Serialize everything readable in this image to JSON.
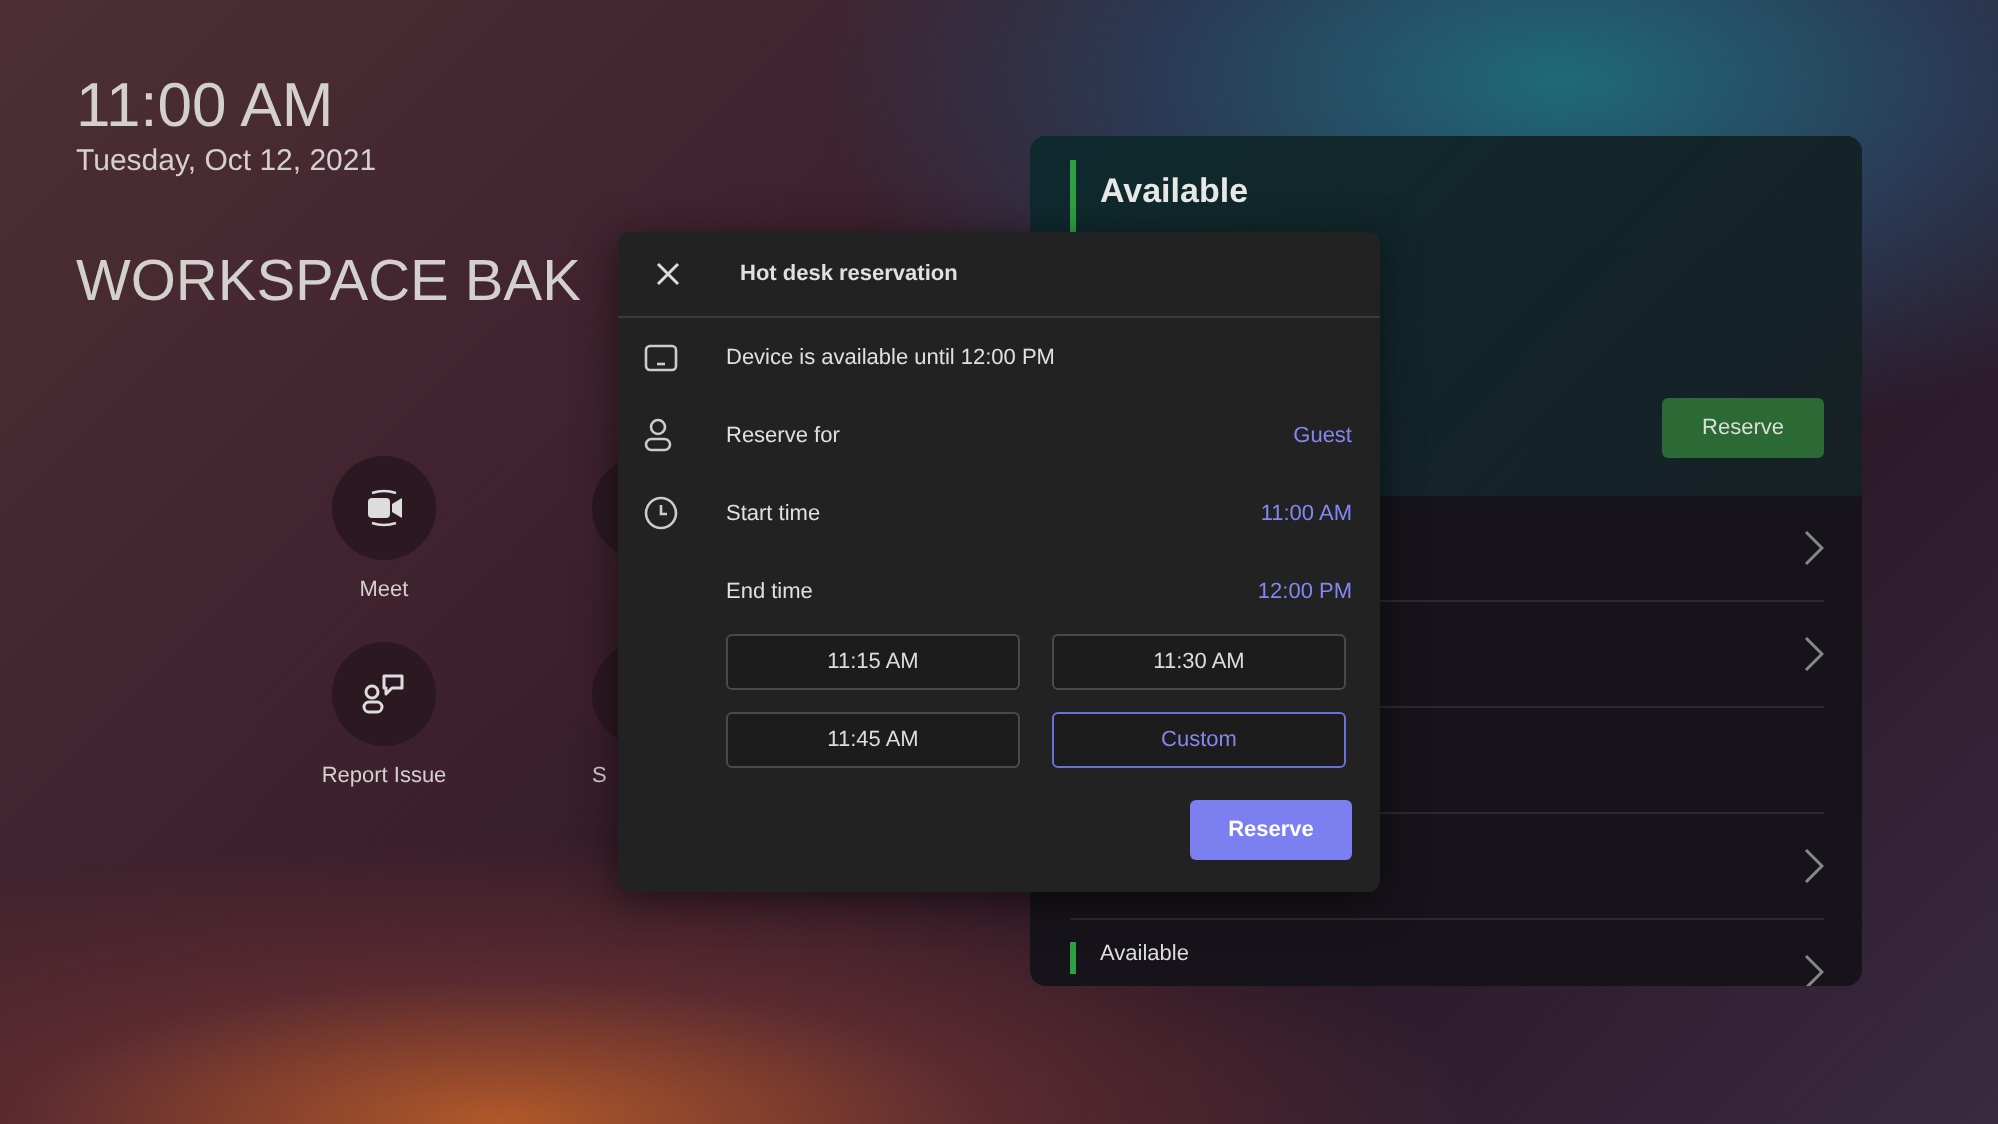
{
  "clock": {
    "time": "11:00 AM",
    "date": "Tuesday, Oct 12, 2021"
  },
  "workspace_name": "WORKSPACE BAK",
  "home_actions": [
    {
      "label": "Meet",
      "kind": "meet"
    },
    {
      "kind": "blank"
    },
    {
      "label": "Report Issue",
      "kind": "report"
    },
    {
      "label": "S",
      "kind": "blank"
    }
  ],
  "schedule_panel": {
    "current": {
      "status": "Available",
      "button": "Reserve"
    },
    "rows": [
      {
        "chevron": true
      },
      {
        "chevron": true
      },
      {
        "chevron": false
      },
      {
        "chevron": true
      },
      {
        "status": "Available",
        "chevron": true
      }
    ]
  },
  "dialog": {
    "title": "Hot desk reservation",
    "rows": [
      {
        "kind": "device",
        "label": "Device is available until 12:00 PM"
      },
      {
        "kind": "person",
        "label": "Reserve for",
        "value": "Guest"
      },
      {
        "kind": "clock",
        "label": "Start time",
        "value": "11:00 AM"
      },
      {
        "kind": "none",
        "label": "End time",
        "value": "12:00 PM"
      }
    ],
    "end_options": [
      {
        "label": "11:15 AM",
        "selected": false
      },
      {
        "label": "11:30 AM",
        "selected": false
      },
      {
        "label": "11:45 AM",
        "selected": false
      },
      {
        "label": "Custom",
        "selected": true
      }
    ],
    "button": "Reserve"
  }
}
